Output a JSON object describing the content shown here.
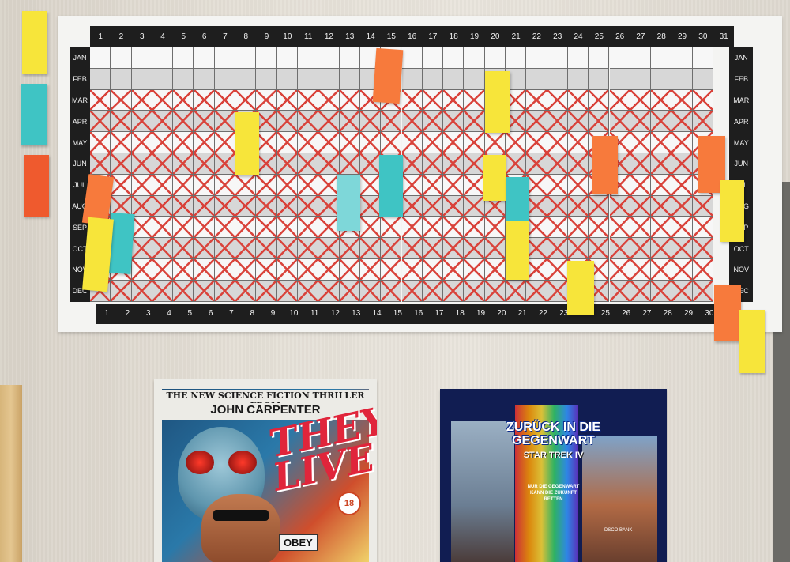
{
  "calendar": {
    "days": [
      "1",
      "2",
      "3",
      "4",
      "5",
      "6",
      "7",
      "8",
      "9",
      "10",
      "11",
      "12",
      "13",
      "14",
      "15",
      "16",
      "17",
      "18",
      "19",
      "20",
      "21",
      "22",
      "23",
      "24",
      "25",
      "26",
      "27",
      "28",
      "29",
      "30",
      "31"
    ],
    "bottom_days": [
      "1",
      "2",
      "3",
      "4",
      "5",
      "6",
      "7",
      "8",
      "9",
      "10",
      "11",
      "12",
      "13",
      "14",
      "15",
      "16",
      "17",
      "18",
      "19",
      "20",
      "21",
      "22",
      "23",
      "24",
      "25",
      "26",
      "27",
      "28",
      "29",
      "30"
    ],
    "months": [
      "JAN",
      "FEB",
      "MAR",
      "APR",
      "MAY",
      "JUN",
      "JUL",
      "AUG",
      "SEP",
      "OCT",
      "NOV",
      "DEC"
    ],
    "crossed_rows_progress": [
      0.0,
      0.0,
      1.0,
      1.0,
      1.0,
      1.0,
      1.0,
      1.0,
      1.0,
      1.0,
      1.0,
      1.0
    ]
  },
  "posters": {
    "they_live": {
      "tagline": "THE NEW SCIENCE FICTION THRILLER FROM",
      "director": "JOHN CARPENTER",
      "title_line1": "THEY",
      "title_line2": "LIVE",
      "rating": "18",
      "sign": "OBEY"
    },
    "star_trek": {
      "title_line1": "ZURÜCK IN DIE",
      "title_line2": "GEGENWART",
      "subtitle": "STAR TREK IV",
      "tagline1": "NUR DIE GEGENWART",
      "tagline2": "KANN DIE ZUKUNFT",
      "tagline3": "RETTEN",
      "bank_sign": "DSCO BANK"
    }
  },
  "colors": {
    "note_yellow": "#f7e53a",
    "note_orange": "#f77a3c",
    "note_teal": "#3fc4c4",
    "note_red": "#ef5a2e",
    "cross_red": "#d9433b"
  }
}
